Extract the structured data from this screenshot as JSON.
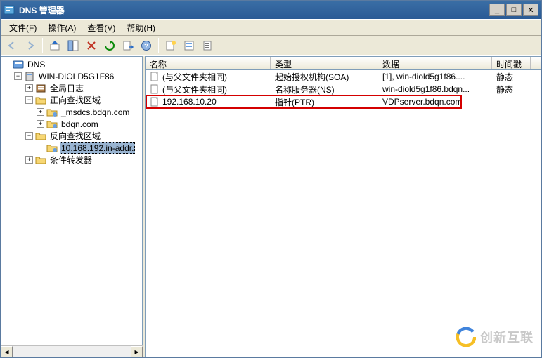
{
  "window": {
    "title": "DNS 管理器"
  },
  "menu": {
    "file": "文件(F)",
    "action": "操作(A)",
    "view": "查看(V)",
    "help": "帮助(H)"
  },
  "tree": {
    "root": "DNS",
    "server": "WIN-DIOLD5G1F86",
    "global_log": "全局日志",
    "fwd_zone": "正向查找区域",
    "fwd_children": {
      "a": "_msdcs.bdqn.com",
      "b": "bdqn.com"
    },
    "rev_zone": "反向查找区域",
    "rev_child": "10.168.192.in-addr.",
    "cond_forwarders": "条件转发器"
  },
  "columns": {
    "name": "名称",
    "type": "类型",
    "data": "数据",
    "ts": "时间戳"
  },
  "rows": [
    {
      "name": "(与父文件夹相同)",
      "type": "起始授权机构(SOA)",
      "data": "[1], win-diold5g1f86....",
      "ts": "静态"
    },
    {
      "name": "(与父文件夹相同)",
      "type": "名称服务器(NS)",
      "data": "win-diold5g1f86.bdqn...",
      "ts": "静态"
    },
    {
      "name": "192.168.10.20",
      "type": "指针(PTR)",
      "data": "VDPserver.bdqn.com",
      "ts": ""
    }
  ],
  "highlight_row_index": 2,
  "watermark": "创新互联"
}
